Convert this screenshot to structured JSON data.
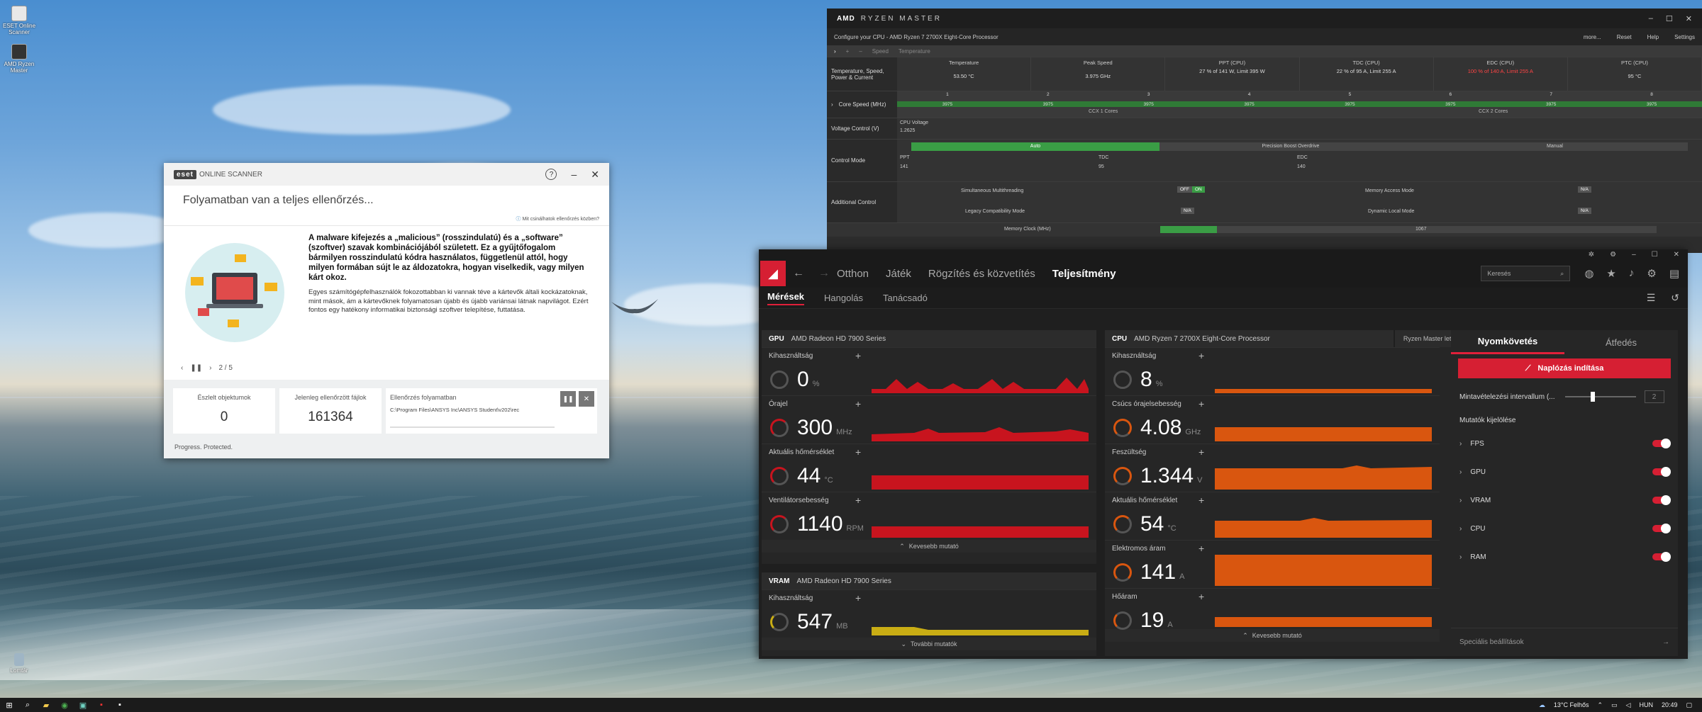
{
  "desktop": {
    "icons": [
      {
        "label": "ESET Online Scanner"
      },
      {
        "label": "AMD Ryzen Master"
      },
      {
        "label": "Lomtár"
      }
    ]
  },
  "taskbar": {
    "weather": "13°C Felhős",
    "time": "20:49",
    "lang": "HUN"
  },
  "eset": {
    "logo": "eset",
    "product": "ONLINE SCANNER",
    "help": "?",
    "heading": "Folyamatban van a teljes ellenőrzés...",
    "link": "Mit csinálhatok ellenőrzés közben?",
    "bold_text": "A malware kifejezés a „malicious” (rosszindulatú) és a „software” (szoftver) szavak kombinációjából született. Ez a gyűjtőfogalom bármilyen rosszindulatú kódra használatos, függetlenül attól, hogy milyen formában sújt le az áldozatokra, hogyan viselkedik, vagy milyen kárt okoz.",
    "body_text": "Egyes számítógépfelhasználók fokozottabban ki vannak téve a kártevők általi kockázatoknak, mint mások, ám a kártevőknek folyamatosan újabb és újabb variánsai látnak napvilágot. Ezért fontos egy hatékony informatikai biztonsági szoftver telepítése, futtatása.",
    "pager": "2 / 5",
    "cards": [
      {
        "label": "Észlelt objektumok",
        "value": "0"
      },
      {
        "label": "Jelenleg ellenőrzött fájlok",
        "value": "161364"
      }
    ],
    "progress_label": "Ellenőrzés folyamatban",
    "progress_path": "C:\\Program Files\\ANSYS Inc\\ANSYS Student\\v202\\rec",
    "footer": "Progress. Protected."
  },
  "ryzen": {
    "brand": "AMD",
    "title": "RYZEN MASTER",
    "subtitle": "Configure your CPU - AMD Ryzen 7 2700X Eight-Core Processor",
    "actions": [
      "more...",
      "Reset",
      "Help",
      "Settings"
    ],
    "tabs": [
      "Speed",
      "Temperature"
    ],
    "row1_label": "Temperature, Speed, Power & Current",
    "stats": [
      {
        "label": "Temperature",
        "value": "53.50 °C",
        "warn": false
      },
      {
        "label": "Peak Speed",
        "value": "3.975 GHz",
        "warn": false
      },
      {
        "label": "PPT (CPU)",
        "value": "27 % of 141 W, Limit 395 W",
        "warn": false
      },
      {
        "label": "TDC (CPU)",
        "value": "22 % of 95 A, Limit 255 A",
        "warn": false
      },
      {
        "label": "EDC (CPU)",
        "value": "100 % of 140 A, Limit 255 A",
        "warn": true
      },
      {
        "label": "PTC (CPU)",
        "value": "95 °C",
        "warn": false
      }
    ],
    "core_label": "Core Speed (MHz)",
    "core_nums": [
      "1",
      "2",
      "3",
      "4",
      "5",
      "6",
      "7",
      "8"
    ],
    "core_speeds": [
      "3975",
      "3975",
      "3975",
      "3975",
      "3975",
      "3975",
      "3975",
      "3975"
    ],
    "ccx1": "CCX 1 Cores",
    "ccx2": "CCX 2 Cores",
    "voltage_label": "Voltage Control (V)",
    "cpu_voltage_label": "CPU Voltage",
    "cpu_voltage": "1.2625",
    "control_label": "Control Mode",
    "modes": [
      "Auto",
      "Precision Boost Overdrive",
      "Manual"
    ],
    "ppt": "PPT",
    "ppt_v": "141",
    "tdc": "TDC",
    "tdc_v": "95",
    "edc": "EDC",
    "edc_v": "140",
    "additional_label": "Additional Control",
    "smt_label": "Simultaneous Multithreading",
    "off": "OFF",
    "on": "ON",
    "mem_access": "Memory Access Mode",
    "na": "N/A",
    "legacy": "Legacy Compatibility Mode",
    "dyn_local": "Dynamic Local Mode",
    "mem_clock": "Memory Clock (MHz)",
    "mem_clock_v": "1067"
  },
  "adrenalin": {
    "nav": [
      "Otthon",
      "Játék",
      "Rögzítés és közvetítés",
      "Teljesítmény"
    ],
    "search": "Keresés",
    "subnav": [
      "Mérések",
      "Hangolás",
      "Tanácsadó"
    ],
    "gpu": {
      "tag": "GPU",
      "name": "AMD Radeon HD 7900 Series",
      "metrics": [
        {
          "label": "Kihasználtság",
          "value": "0",
          "unit": "%"
        },
        {
          "label": "Órajel",
          "value": "300",
          "unit": "MHz"
        },
        {
          "label": "Aktuális hőmérséklet",
          "value": "44",
          "unit": "°C"
        },
        {
          "label": "Ventilátorsebesség",
          "value": "1140",
          "unit": "RPM"
        }
      ],
      "less": "Kevesebb mutató"
    },
    "vram": {
      "tag": "VRAM",
      "name": "AMD Radeon HD 7900 Series",
      "metrics": [
        {
          "label": "Kihasználtság",
          "value": "547",
          "unit": "MB"
        }
      ],
      "more": "További mutatók"
    },
    "cpu": {
      "tag": "CPU",
      "name": "AMD Ryzen 7 2700X Eight-Core Processor",
      "download": "Ryzen Master letöltése",
      "metrics": [
        {
          "label": "Kihasználtság",
          "value": "8",
          "unit": "%"
        },
        {
          "label": "Csúcs órajelsebesség",
          "value": "4.08",
          "unit": "GHz"
        },
        {
          "label": "Feszültség",
          "value": "1.344",
          "unit": "V"
        },
        {
          "label": "Aktuális hőmérséklet",
          "value": "54",
          "unit": "°C"
        },
        {
          "label": "Elektromos áram",
          "value": "141",
          "unit": "A"
        },
        {
          "label": "Hőáram",
          "value": "19",
          "unit": "A"
        }
      ],
      "less": "Kevesebb mutató"
    },
    "tracking": {
      "tabs": [
        "Nyomkövetés",
        "Átfedés"
      ],
      "record": "Naplózás indítása",
      "interval_label": "Mintavételezési intervallum (...",
      "interval_value": "2",
      "select_label": "Mutatók kijelölése",
      "items": [
        "FPS",
        "GPU",
        "VRAM",
        "CPU",
        "RAM"
      ],
      "advanced": "Speciális beállítások"
    },
    "colors": {
      "accent": "#d61f33",
      "gpu_chart": "#c8141e",
      "cpu_chart": "#d9560f",
      "vram_chart": "#c9ad14"
    }
  }
}
